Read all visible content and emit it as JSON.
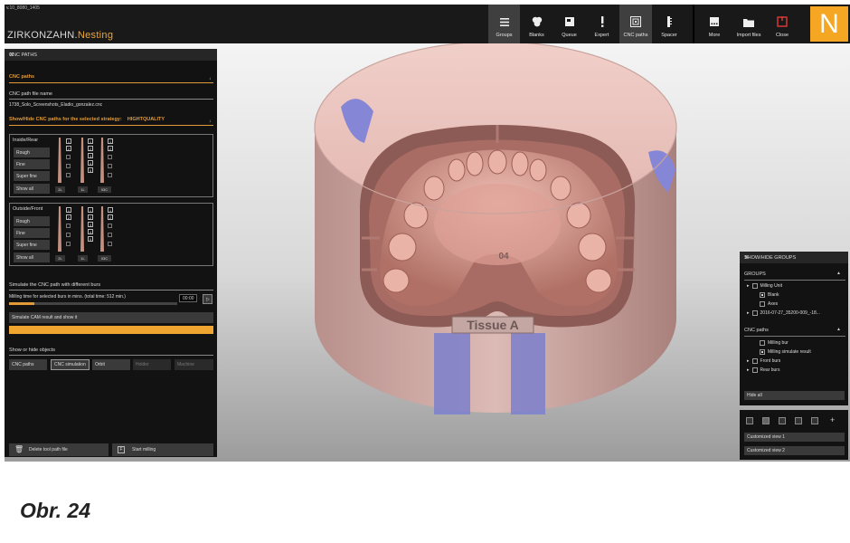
{
  "app": {
    "version": "v.10_8080_1405",
    "brand_main": "ZIRKONZAHN.",
    "brand_accent": "Nesting",
    "logo_letter": "N"
  },
  "toolbar": {
    "items": [
      {
        "id": "groups",
        "label": "Groups",
        "icon": "menu-icon",
        "active": true
      },
      {
        "id": "blanks",
        "label": "Blanks",
        "icon": "blanks-icon"
      },
      {
        "id": "queue",
        "label": "Queue",
        "icon": "queue-icon"
      },
      {
        "id": "expert",
        "label": "Expert",
        "icon": "exclamation-icon"
      },
      {
        "id": "cnc",
        "label": "CNC paths",
        "icon": "cnc-paths-icon",
        "active": true
      },
      {
        "id": "spacer",
        "label": "Spacer",
        "icon": "spacer-icon"
      }
    ],
    "right_items": [
      {
        "id": "more",
        "label": "More",
        "icon": "more-icon"
      },
      {
        "id": "import",
        "label": "Import files",
        "icon": "folder-icon"
      },
      {
        "id": "close",
        "label": "Close",
        "icon": "power-icon"
      }
    ]
  },
  "left_panel": {
    "title": "CNC PATHS",
    "section_cnc": "CNC paths",
    "file_label": "CNC path file name",
    "file_name": "1738_Solo_Screenshots_Eladio_gonzalez.cnc",
    "showhide_label": "Show/Hide CNC paths for the selected strategy:",
    "strategy": "HIGHTQUALITY",
    "inside_group": {
      "title": "Inside/Rear",
      "buttons": [
        "Rough",
        "Fine",
        "Super fine",
        "Show all"
      ]
    },
    "outside_group": {
      "title": "Outside/Front",
      "buttons": [
        "Rough",
        "Fine",
        "Super fine",
        "Show all"
      ]
    },
    "bur_labels": [
      "2L",
      "1L",
      "03C"
    ],
    "bur_nums_a": [
      "1",
      "2"
    ],
    "bur_nums_b": [
      "1",
      "2",
      "3",
      "4",
      "5"
    ],
    "bur_nums_c": [
      "1",
      "2"
    ],
    "simulate_label": "Simulate the CNC path with different burs",
    "milling_time": "Milling time for selected burs in mins. (total time: 512  min.)",
    "time_value": "00:00",
    "simulate_button": "Simulate CAM result and show it",
    "objects_label": "Show or hide objects",
    "objects_buttons": [
      "CNC paths",
      "CNC simulation",
      "Orbit",
      "Holder",
      "Machine"
    ],
    "delete_button": "Delete tool path file",
    "start_button": "Start milling"
  },
  "right_panel": {
    "title": "SHOW/HIDE GROUPS",
    "groups_label": "GROUPS",
    "milling_unit": "Milling Unit",
    "blank": "Blank",
    "axes": "Axes",
    "job": "2016-07-27_35200-009_-18...",
    "cnc_label": "CNC paths",
    "milling_bur": "Milling bur",
    "milling_sim": "Milling simulate result",
    "front_burs": "Front burs",
    "rear_burs": "Rear burs",
    "hide_all": "Hide all",
    "view1": "Customized view 1",
    "view2": "Customized view 2"
  },
  "scene": {
    "engraving": "Tissue A",
    "engraving2": "04"
  },
  "caption": "Obr. 24"
}
